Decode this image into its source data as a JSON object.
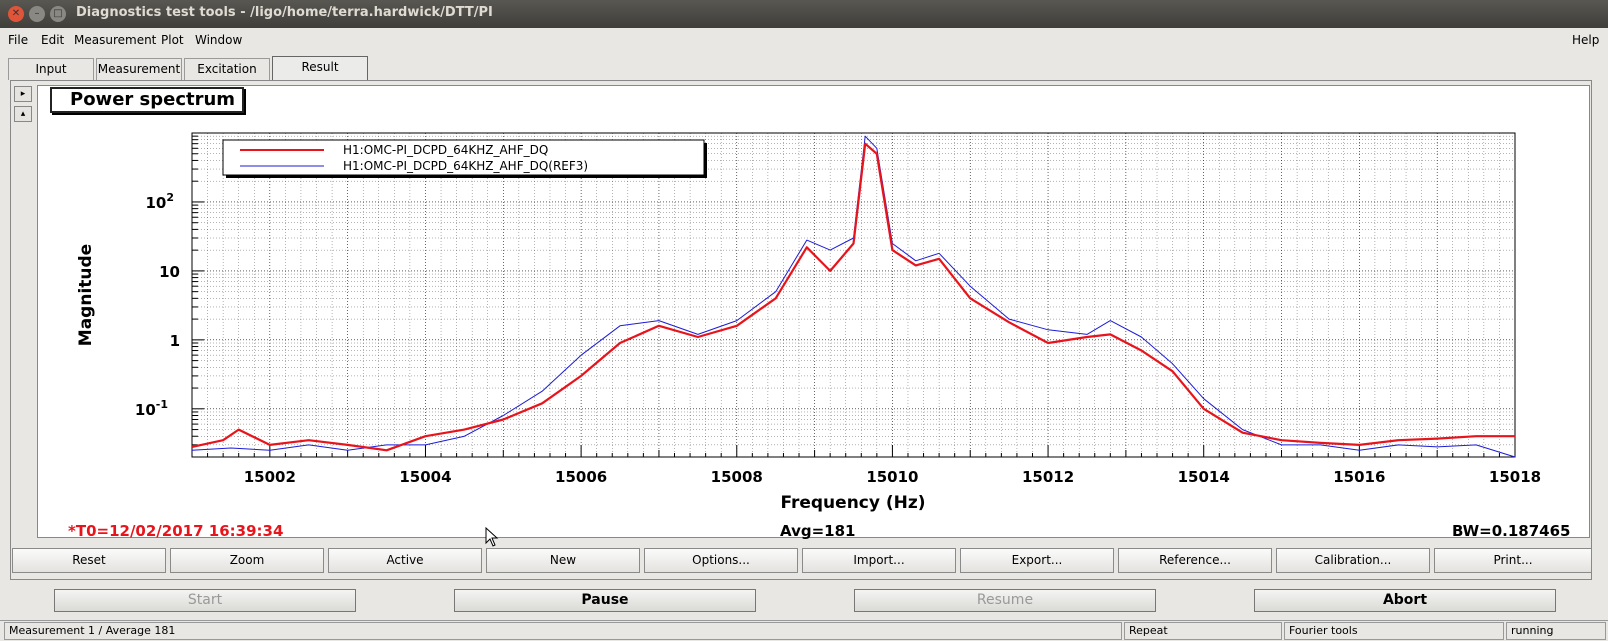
{
  "window": {
    "title": "Diagnostics test tools - /ligo/home/terra.hardwick/DTT/PI"
  },
  "menu": {
    "file": "File",
    "edit": "Edit",
    "measurement": "Measurement",
    "plot": "Plot",
    "window": "Window",
    "help": "Help"
  },
  "tabs": [
    "Input",
    "Measurement",
    "Excitation",
    "Result"
  ],
  "plot": {
    "title": "Power spectrum",
    "xlabel": "Frequency (Hz)",
    "ylabel": "Magnitude",
    "t0": "*T0=12/02/2017 16:39:34",
    "avg": "Avg=181",
    "bw": "BW=0.187465"
  },
  "chart_data": {
    "type": "line",
    "x_scale": "linear",
    "y_scale": "log",
    "xlim": [
      15001,
      15018
    ],
    "ylim": [
      0.02,
      1000
    ],
    "x_ticks": [
      "15002",
      "15004",
      "15006",
      "15008",
      "15010",
      "15012",
      "15014",
      "15016",
      "15018"
    ],
    "y_ticks": [
      "10-1",
      "1",
      "10",
      "102"
    ],
    "grid": true,
    "legend_position": "top-left",
    "series": [
      {
        "name": "H1:OMC-PI_DCPD_64KHZ_AHF_DQ",
        "color": "#e8141c",
        "x": [
          15001,
          15001.4,
          15001.6,
          15002,
          15002.5,
          15003,
          15003.5,
          15004,
          15004.5,
          15005,
          15005.5,
          15006,
          15006.5,
          15007,
          15007.5,
          15008,
          15008.5,
          15008.9,
          15009.2,
          15009.5,
          15009.65,
          15009.8,
          15010,
          15010.3,
          15010.6,
          15011,
          15011.5,
          15012,
          15012.5,
          15012.8,
          15013.2,
          15013.6,
          15014,
          15014.5,
          15015,
          15015.5,
          15016,
          15016.5,
          15017,
          15017.5,
          15018
        ],
        "y": [
          0.028,
          0.035,
          0.05,
          0.03,
          0.035,
          0.03,
          0.025,
          0.04,
          0.05,
          0.07,
          0.12,
          0.3,
          0.9,
          1.6,
          1.1,
          1.6,
          4,
          22,
          10,
          25,
          700,
          500,
          20,
          12,
          15,
          4,
          1.8,
          0.9,
          1.1,
          1.2,
          0.7,
          0.35,
          0.1,
          0.045,
          0.035,
          0.032,
          0.03,
          0.035,
          0.037,
          0.04,
          0.04
        ]
      },
      {
        "name": "H1:OMC-PI_DCPD_64KHZ_AHF_DQ(REF3)",
        "color": "#1c1cd6",
        "x": [
          15001,
          15001.5,
          15002,
          15002.5,
          15003,
          15003.5,
          15004,
          15004.5,
          15005,
          15005.5,
          15006,
          15006.5,
          15007,
          15007.5,
          15008,
          15008.5,
          15008.9,
          15009.2,
          15009.5,
          15009.65,
          15009.8,
          15010,
          15010.3,
          15010.6,
          15011,
          15011.5,
          15012,
          15012.5,
          15012.8,
          15013.2,
          15013.6,
          15014,
          15014.5,
          15015,
          15015.5,
          15016,
          15016.5,
          15017,
          15017.5,
          15018
        ],
        "y": [
          0.025,
          0.027,
          0.025,
          0.03,
          0.025,
          0.03,
          0.03,
          0.04,
          0.08,
          0.18,
          0.6,
          1.6,
          1.9,
          1.2,
          1.9,
          5,
          28,
          20,
          30,
          900,
          600,
          25,
          14,
          18,
          6,
          2,
          1.4,
          1.2,
          1.9,
          1.1,
          0.45,
          0.14,
          0.05,
          0.03,
          0.03,
          0.025,
          0.03,
          0.028,
          0.03,
          0.02
        ]
      }
    ]
  },
  "toolbar": [
    "Reset",
    "Zoom",
    "Active",
    "New",
    "Options...",
    "Import...",
    "Export...",
    "Reference...",
    "Calibration...",
    "Print..."
  ],
  "run": {
    "start": "Start",
    "pause": "Pause",
    "resume": "Resume",
    "abort": "Abort"
  },
  "status": {
    "left": "Measurement 1 / Average 181",
    "repeat": "Repeat",
    "tools": "Fourier tools",
    "state": "running"
  }
}
